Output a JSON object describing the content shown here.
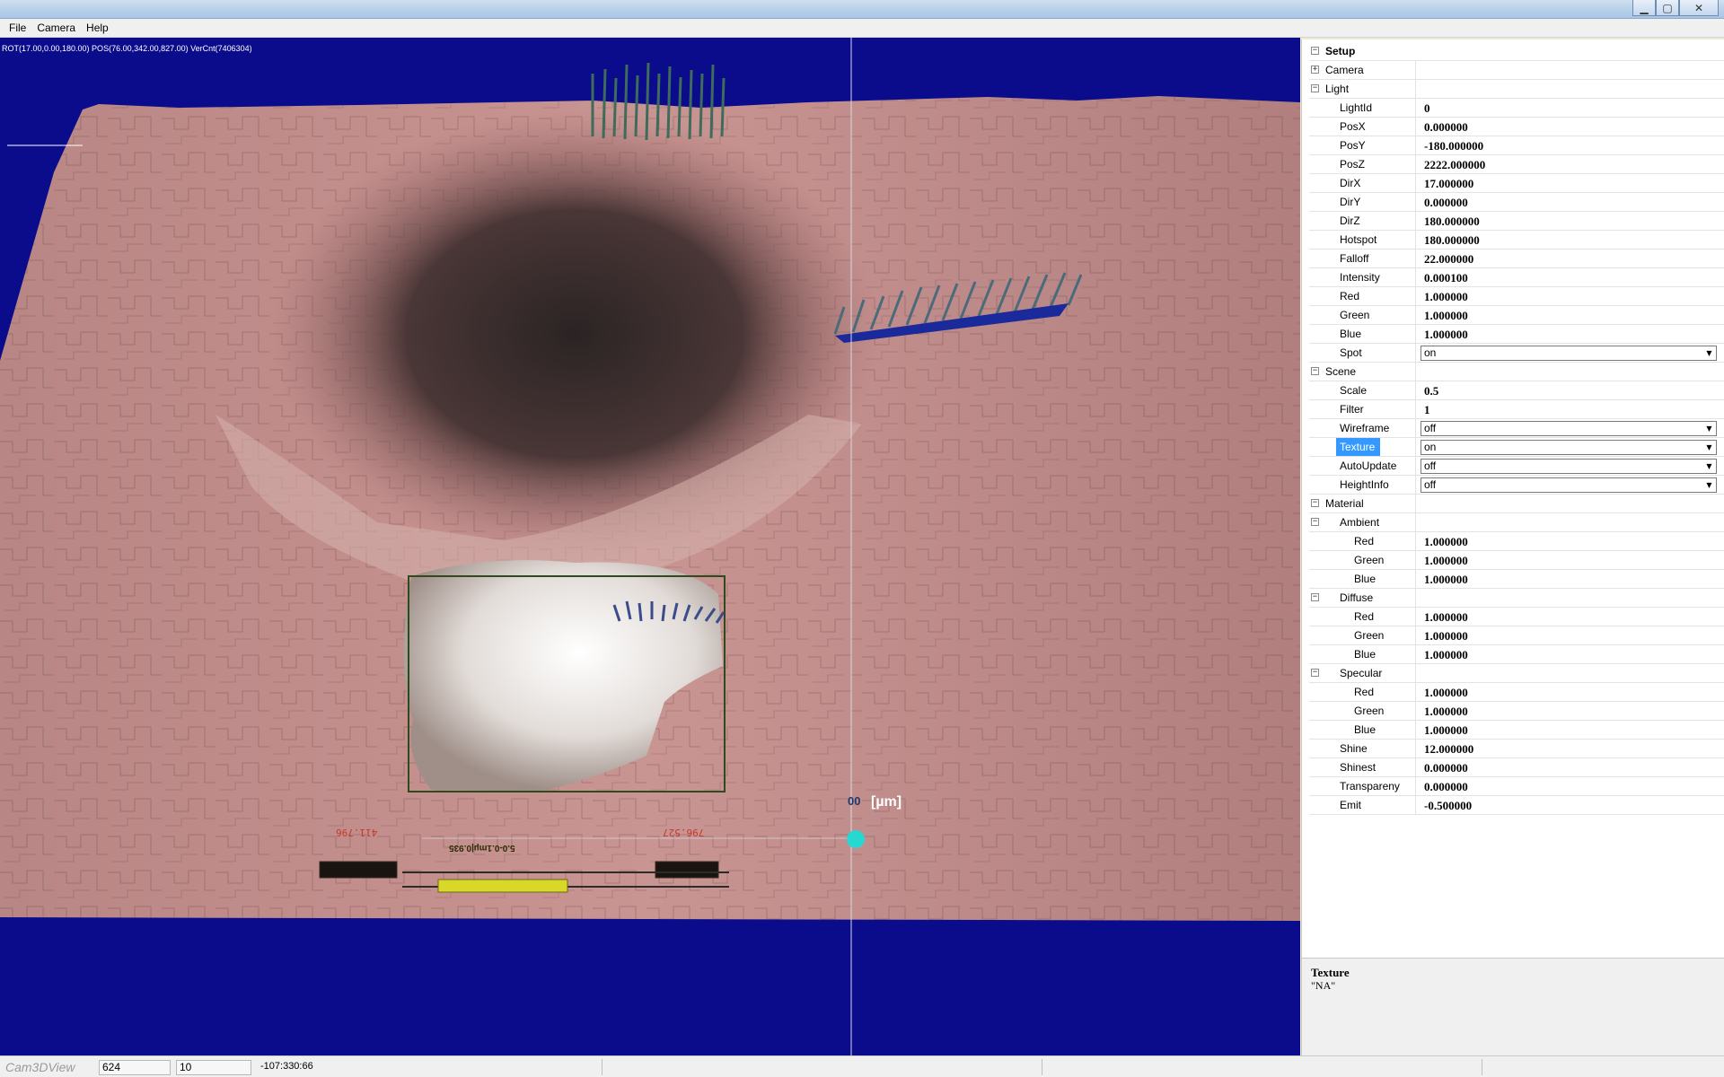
{
  "window": {
    "controls": {
      "minimize": "▁",
      "maximize": "▢",
      "close": "✕"
    }
  },
  "menu": [
    "File",
    "Camera",
    "Help"
  ],
  "viewport": {
    "hud": "ROT(17.00,0.00,180.00) POS(76.00,342.00,827.00) VerCnt(7406304)",
    "unit_label": "[µm]",
    "marker_label": "00",
    "ruler_left": "411.796",
    "ruler_right": "796.527",
    "ruler_caption": "5.0-0.1mµ|0.935",
    "colors": {
      "background": "#0b0c8c",
      "terrain": "#c48e8c"
    }
  },
  "properties": {
    "root": "Setup",
    "camera": "Camera",
    "light": {
      "label": "Light",
      "rows": [
        {
          "name": "LightId",
          "value": "0"
        },
        {
          "name": "PosX",
          "value": "0.000000"
        },
        {
          "name": "PosY",
          "value": "-180.000000"
        },
        {
          "name": "PosZ",
          "value": "2222.000000"
        },
        {
          "name": "DirX",
          "value": "17.000000"
        },
        {
          "name": "DirY",
          "value": "0.000000"
        },
        {
          "name": "DirZ",
          "value": "180.000000"
        },
        {
          "name": "Hotspot",
          "value": "180.000000"
        },
        {
          "name": "Falloff",
          "value": "22.000000"
        },
        {
          "name": "Intensity",
          "value": "0.000100"
        },
        {
          "name": "Red",
          "value": "1.000000"
        },
        {
          "name": "Green",
          "value": "1.000000"
        },
        {
          "name": "Blue",
          "value": "1.000000"
        }
      ],
      "spot": {
        "name": "Spot",
        "value": "on"
      }
    },
    "scene": {
      "label": "Scene",
      "scale": {
        "name": "Scale",
        "value": "0.5"
      },
      "filter": {
        "name": "Filter",
        "value": "1"
      },
      "wireframe": {
        "name": "Wireframe",
        "value": "off"
      },
      "texture": {
        "name": "Texture",
        "value": "on"
      },
      "autoupdate": {
        "name": "AutoUpdate",
        "value": "off"
      },
      "heightinfo": {
        "name": "HeightInfo",
        "value": "off"
      }
    },
    "material": {
      "label": "Material",
      "ambient": {
        "label": "Ambient",
        "red": "1.000000",
        "green": "1.000000",
        "blue": "1.000000"
      },
      "diffuse": {
        "label": "Diffuse",
        "red": "1.000000",
        "green": "1.000000",
        "blue": "1.000000"
      },
      "specular": {
        "label": "Specular",
        "red": "1.000000",
        "green": "1.000000",
        "blue": "1.000000"
      },
      "channel_names": {
        "red": "Red",
        "green": "Green",
        "blue": "Blue"
      },
      "shine": {
        "name": "Shine",
        "value": "12.000000"
      },
      "shinest": {
        "name": "Shinest",
        "value": "0.000000"
      },
      "transpareny": {
        "name": "Transpareny",
        "value": "0.000000"
      },
      "emit": {
        "name": "Emit",
        "value": "-0.500000"
      }
    }
  },
  "description": {
    "title": "Texture",
    "text": "\"NA\""
  },
  "status": {
    "app_name": "Cam3DView",
    "field1": "624",
    "field2": "10",
    "coords": "-107:330:66"
  },
  "icons": {
    "expand": "+",
    "collapse": "−",
    "dropdown": "▼"
  }
}
